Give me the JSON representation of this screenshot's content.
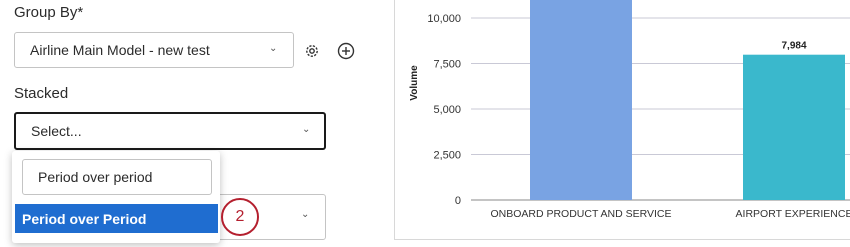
{
  "form": {
    "group_by_label": "Group By*",
    "group_by_value": "Airline Main Model - new test",
    "stacked_label": "Stacked",
    "stacked_value": "Select..."
  },
  "dropdown": {
    "search_value": "Period over period",
    "option_highlighted": "Period over Period"
  },
  "step_badge": "2",
  "colors": {
    "accent": "#1f6dd0",
    "badge": "#b41f2e",
    "bar1": "#79a3e3",
    "bar2": "#3ab8cc"
  },
  "icons": {
    "settings": "gear-icon",
    "add": "plus-circle-icon",
    "caret": "chevron-down-icon"
  },
  "chart_data": {
    "type": "bar",
    "categories": [
      "ONBOARD PRODUCT AND SERVICE",
      "AIRPORT EXPERIENCE"
    ],
    "values": [
      12500,
      7984
    ],
    "data_labels": [
      "",
      "7,984"
    ],
    "ylabel": "Volume",
    "yticks": [
      "0",
      "2,500",
      "5,000",
      "7,500",
      "10,000"
    ],
    "ylim": [
      0,
      12000
    ],
    "grid": true
  }
}
